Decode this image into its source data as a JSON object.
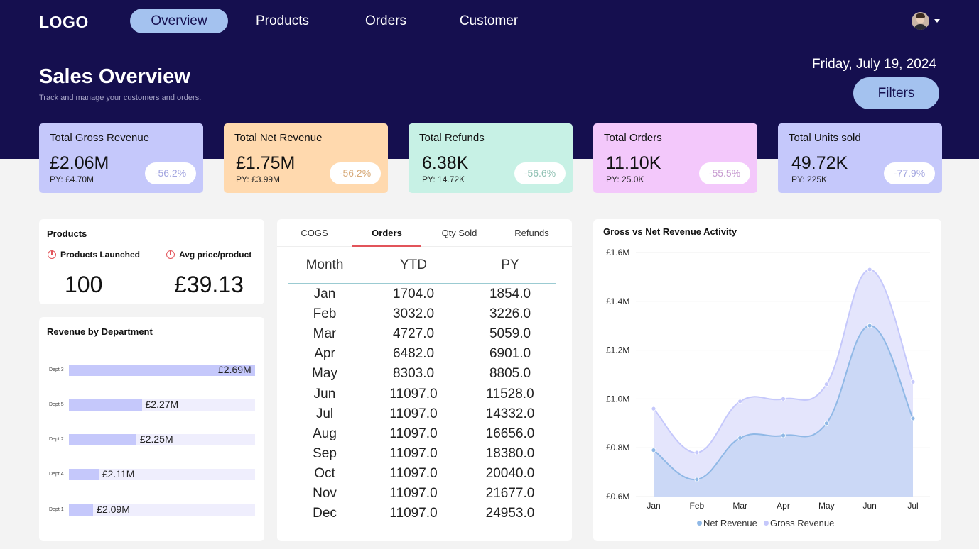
{
  "nav": {
    "logo": "LOGO",
    "tabs": [
      {
        "label": "Overview",
        "active": true
      },
      {
        "label": "Products",
        "active": false
      },
      {
        "label": "Orders",
        "active": false
      },
      {
        "label": "Customer",
        "active": false
      }
    ]
  },
  "header": {
    "title": "Sales Overview",
    "subtitle": "Track and manage your customers and orders.",
    "date": "Friday, July 19, 2024",
    "filters_label": "Filters"
  },
  "kpis": [
    {
      "label": "Total Gross Revenue",
      "value": "£2.06M",
      "py": "PY: £4.70M",
      "change": "-56.2%",
      "bg": "#c5c8fb",
      "change_color": "#a3a6e0"
    },
    {
      "label": "Total Net Revenue",
      "value": "£1.75M",
      "py": "PY: £3.99M",
      "change": "-56.2%",
      "bg": "#ffd9ae",
      "change_color": "#d8ab7a"
    },
    {
      "label": "Total Refunds",
      "value": "6.38K",
      "py": "PY: 14.72K",
      "change": "-56.6%",
      "bg": "#c7f1e5",
      "change_color": "#8fc1b3"
    },
    {
      "label": "Total Orders",
      "value": "11.10K",
      "py": "PY: 25.0K",
      "change": "-55.5%",
      "bg": "#f3c8fb",
      "change_color": "#c79ad0"
    },
    {
      "label": "Total Units sold",
      "value": "49.72K",
      "py": "PY: 225K",
      "change": "-77.9%",
      "bg": "#c5c8fb",
      "change_color": "#a3a6e0"
    }
  ],
  "products": {
    "title": "Products",
    "launched_label": "Products Launched",
    "launched_value": "100",
    "avg_label": "Avg price/product",
    "avg_value": "£39.13"
  },
  "departments": {
    "title": "Revenue by Department",
    "rows": [
      {
        "label": "Dept 3",
        "value": 2.69,
        "display": "£2.69M"
      },
      {
        "label": "Dept 5",
        "value": 2.27,
        "display": "£2.27M"
      },
      {
        "label": "Dept 2",
        "value": 2.25,
        "display": "£2.25M"
      },
      {
        "label": "Dept 4",
        "value": 2.11,
        "display": "£2.11M"
      },
      {
        "label": "Dept 1",
        "value": 2.09,
        "display": "£2.09M"
      }
    ],
    "axis_min": 2.0,
    "axis_max": 2.69
  },
  "orders_table": {
    "tabs": [
      {
        "label": "COGS",
        "active": false
      },
      {
        "label": "Orders",
        "active": true
      },
      {
        "label": "Qty Sold",
        "active": false
      },
      {
        "label": "Refunds",
        "active": false
      }
    ],
    "columns": [
      "Month",
      "YTD",
      "PY"
    ],
    "rows": [
      [
        "Jan",
        "1704.0",
        "1854.0"
      ],
      [
        "Feb",
        "3032.0",
        "3226.0"
      ],
      [
        "Mar",
        "4727.0",
        "5059.0"
      ],
      [
        "Apr",
        "6482.0",
        "6901.0"
      ],
      [
        "May",
        "8303.0",
        "8805.0"
      ],
      [
        "Jun",
        "11097.0",
        "11528.0"
      ],
      [
        "Jul",
        "11097.0",
        "14332.0"
      ],
      [
        "Aug",
        "11097.0",
        "16656.0"
      ],
      [
        "Sep",
        "11097.0",
        "18380.0"
      ],
      [
        "Oct",
        "11097.0",
        "20040.0"
      ],
      [
        "Nov",
        "11097.0",
        "21677.0"
      ],
      [
        "Dec",
        "11097.0",
        "24953.0"
      ]
    ]
  },
  "chart_data": {
    "type": "area",
    "title": "Gross vs Net Revenue Activity",
    "categories": [
      "Jan",
      "Feb",
      "Mar",
      "Apr",
      "May",
      "Jun",
      "Jul"
    ],
    "series": [
      {
        "name": "Net Revenue",
        "values": [
          0.79,
          0.67,
          0.84,
          0.85,
          0.9,
          1.3,
          0.92
        ],
        "color": "#8fb8e6",
        "fill": "#c7d6f5"
      },
      {
        "name": "Gross Revenue",
        "values": [
          0.96,
          0.78,
          0.99,
          1.0,
          1.06,
          1.53,
          1.07
        ],
        "color": "#c5c8fb",
        "fill": "#e4e5fc"
      }
    ],
    "y_ticks": [
      "£0.6M",
      "£0.8M",
      "£1.0M",
      "£1.2M",
      "£1.4M",
      "£1.6M"
    ],
    "ylim": [
      0.6,
      1.6
    ],
    "grid": true,
    "legend_position": "bottom-center"
  }
}
